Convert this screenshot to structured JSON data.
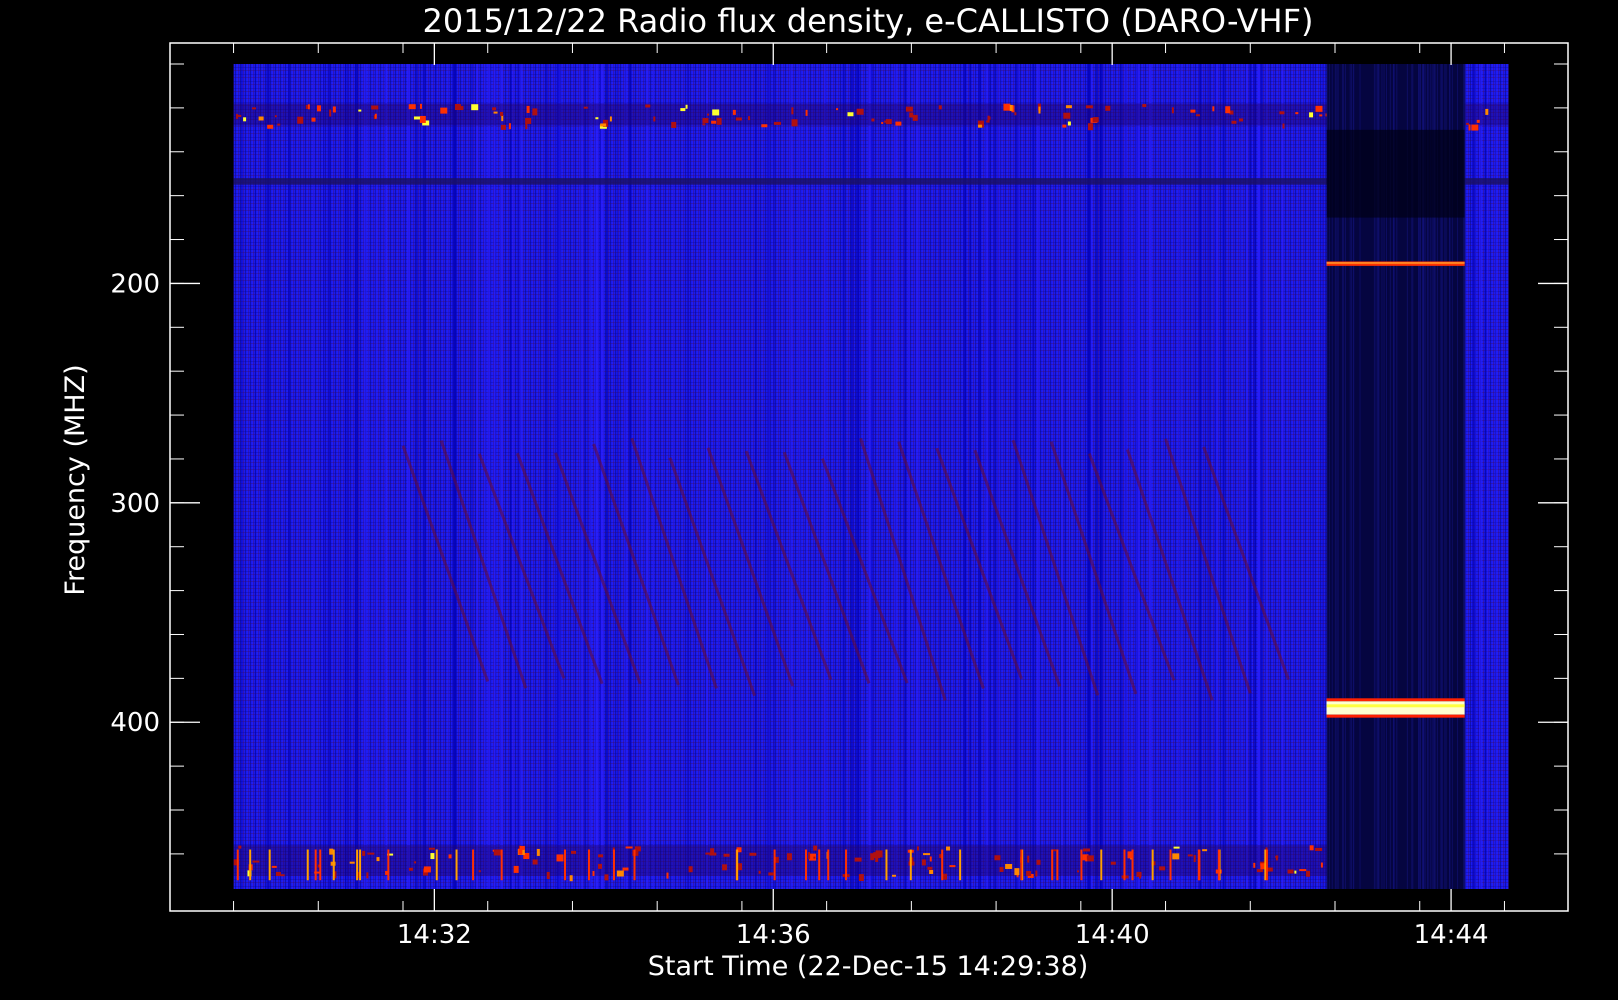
{
  "chart_data": {
    "type": "heatmap",
    "title": "2015/12/22  Radio flux density, e-CALLISTO (DARO-VHF)",
    "xlabel": "Start Time (22-Dec-15 14:29:38)",
    "ylabel": "Frequency (MHZ)",
    "x_unit": "minutes after 14:29:38",
    "x_range_minutes": [
      -0.75,
      15.75
    ],
    "data_x_range_minutes": [
      0,
      15.05
    ],
    "y_range_mhz": [
      100,
      476
    ],
    "y_reversed": true,
    "x_ticks": [
      {
        "label": "14:32",
        "minutes": 2.37
      },
      {
        "label": "14:36",
        "minutes": 6.37
      },
      {
        "label": "14:40",
        "minutes": 10.37
      },
      {
        "label": "14:44",
        "minutes": 14.37
      }
    ],
    "y_ticks": [
      {
        "label": "200",
        "mhz": 200
      },
      {
        "label": "300",
        "mhz": 300
      },
      {
        "label": "400",
        "mhz": 400
      }
    ],
    "colormap": [
      "#000000",
      "#0000ff",
      "#8b0000",
      "#ff3000",
      "#ffff00",
      "#ffffff"
    ],
    "background_color": "#1a1aee",
    "features": [
      {
        "kind": "rfi-band",
        "mhz_start": 118,
        "mhz_end": 128,
        "minutes_start": 0,
        "minutes_end": 15.05,
        "intensity": "medium"
      },
      {
        "kind": "dark-line",
        "mhz_start": 152,
        "mhz_end": 155,
        "minutes_start": 0,
        "minutes_end": 15.05,
        "intensity": "low"
      },
      {
        "kind": "calibration-segment",
        "mhz_start": 100,
        "mhz_end": 476,
        "minutes_start": 12.9,
        "minutes_end": 14.53,
        "intensity": "dark"
      },
      {
        "kind": "bright-line",
        "mhz_start": 190,
        "mhz_end": 192,
        "minutes_start": 12.9,
        "minutes_end": 14.53,
        "intensity": "high"
      },
      {
        "kind": "bright-line",
        "mhz_start": 390,
        "mhz_end": 397,
        "minutes_start": 12.9,
        "minutes_end": 14.53,
        "intensity": "saturated"
      },
      {
        "kind": "rfi-band",
        "mhz_start": 456,
        "mhz_end": 470,
        "minutes_start": 0,
        "minutes_end": 12.9,
        "intensity": "medium"
      },
      {
        "kind": "diagonal-striations",
        "mhz_start": 270,
        "mhz_end": 390,
        "minutes_start": 2,
        "minutes_end": 11.5,
        "intensity": "low"
      }
    ]
  }
}
